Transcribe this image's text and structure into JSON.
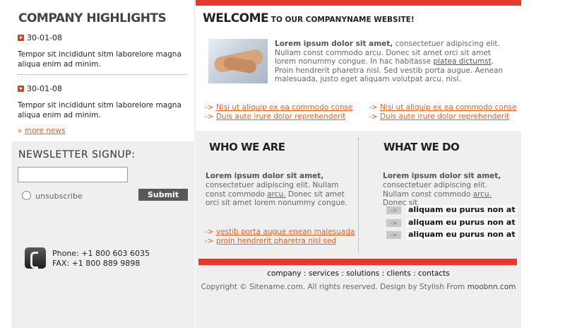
{
  "highlights": {
    "title": "COMPANY HIGHLIGHTS",
    "items": [
      {
        "date": "30-01-08",
        "text": "Tempor sit incididunt sitm laborelore magna aliqua enim ad minim."
      },
      {
        "date": "30-01-08",
        "text": "Tempor sit incididunt sitm laborelore magna aliqua enim ad minim."
      }
    ],
    "more_prefix": "»",
    "more_label": "more news"
  },
  "newsletter": {
    "title": "NEWSLETTER SIGNUP:",
    "input_value": "",
    "unsubscribe_label": "unsubscribe",
    "submit_label": "Submit"
  },
  "contact": {
    "phone": "Phone: +1 800 603 6035",
    "fax": "FAX: +1 800 889 9898"
  },
  "welcome": {
    "title_big": "WELCOME",
    "title_small": " TO OUR COMPANYNAME WEBSITE!",
    "intro_bold": "Lorem ipsum dolor sit amet,",
    "intro_1": " consectetuer adipiscing elit. Nullam const commodo arcu. Donec sit amet orci sit amet lorem nonummy congue. In hac habitasse ",
    "intro_link": "platea dictumst",
    "intro_2": ". Proin hendrerit pharetra nisl. Sed vestib porta augue. Aenean malesuada, justo eget aliquam volutpat arcu. nisl.",
    "links_left": [
      "Nisi ut aliquip ex ea commodo conse",
      "Duis aute irure dolor reprehenderit"
    ],
    "links_right": [
      "Nisi ut aliquip ex ea commodo conse",
      "Duis aute irure dolor reprehenderit"
    ],
    "arrow": "->"
  },
  "who": {
    "title": "WHO WE ARE",
    "text_bold": "Lorem ipsum dolor sit amet,",
    "text_1": " consectetuer adipiscing elit. Nullam const commodo ",
    "text_link": "arcu.",
    "text_2": " Donec sit amet orci sit amet lorem nonummy congue.",
    "links": [
      "vestib porta augue enean malesuada",
      "proin hendrerit pharetra nisl sed"
    ]
  },
  "what": {
    "title": "WHAT WE DO",
    "text_bold": "Lorem ipsum dolor sit amet,",
    "text_1": " consectetuer adipiscing elit. Nullam const commodo ",
    "text_link": "arcu.",
    "text_2": " Donec sit",
    "bullets": [
      "aliquam eu purus non at",
      "aliquam eu purus non at",
      "aliquam eu purus non at"
    ],
    "bullet_tag": "->"
  },
  "footer": {
    "nav": [
      "company",
      "services",
      "solutions",
      "clients",
      "contacts"
    ],
    "sep": " : ",
    "copyright": "Copyright © Sitename.com. All rights reserved. Design by Stylish From ",
    "brand": "moobnn.com"
  },
  "colors": {
    "accent_red": "#e53a2b",
    "link_orange": "#e8621c",
    "panel_gray": "#efefef"
  }
}
